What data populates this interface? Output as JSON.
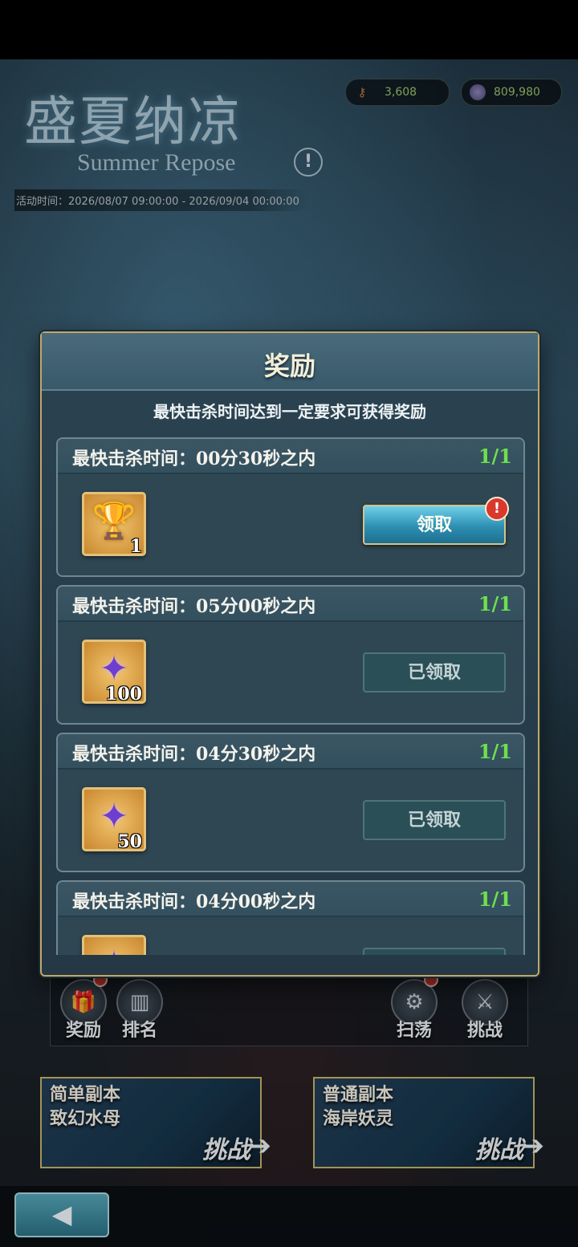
{
  "header": {
    "title_cn": "盛夏纳凉",
    "title_en": "Summer Repose",
    "activity_time": "活动时间：2026/08/07 09:00:00 - 2026/09/04 00:00:00",
    "currency": [
      {
        "icon": "key-icon",
        "value": "3,608"
      },
      {
        "icon": "coin-icon",
        "value": "809,980"
      }
    ]
  },
  "background_menu": {
    "items": [
      {
        "label": "奖励",
        "icon": "gift-icon"
      },
      {
        "label": "排名",
        "icon": "podium-icon"
      },
      {
        "label": "扫荡",
        "icon": "gear-icon"
      },
      {
        "label": "挑战",
        "icon": "crossed-swords-icon"
      }
    ],
    "stages": [
      {
        "name": "简单副本\n致幻水母",
        "action": "挑战"
      },
      {
        "name": "普通副本\n海岸妖灵",
        "action": "挑战"
      }
    ]
  },
  "dialog": {
    "title": "奖励",
    "subtitle": "最快击杀时间达到一定要求可获得奖励",
    "rows": [
      {
        "condition": "最快击杀时间：00分30秒之内",
        "progress": "1/1",
        "item_icon": "trophy-icon",
        "quantity": "1",
        "button_label": "领取",
        "claimed": false,
        "has_alert": true
      },
      {
        "condition": "最快击杀时间：05分00秒之内",
        "progress": "1/1",
        "item_icon": "purple-star-icon",
        "quantity": "100",
        "button_label": "已领取",
        "claimed": true,
        "has_alert": false
      },
      {
        "condition": "最快击杀时间：04分30秒之内",
        "progress": "1/1",
        "item_icon": "purple-star-icon",
        "quantity": "50",
        "button_label": "已领取",
        "claimed": true,
        "has_alert": false
      },
      {
        "condition": "最快击杀时间：04分00秒之内",
        "progress": "1/1",
        "item_icon": "purple-star-icon",
        "quantity": "",
        "button_label": "",
        "claimed": true,
        "has_alert": false
      }
    ]
  },
  "colors": {
    "progress_green": "#6de04f",
    "frame_gold": "#c0a86a",
    "claim_button_blue": "#2d8fb2"
  }
}
